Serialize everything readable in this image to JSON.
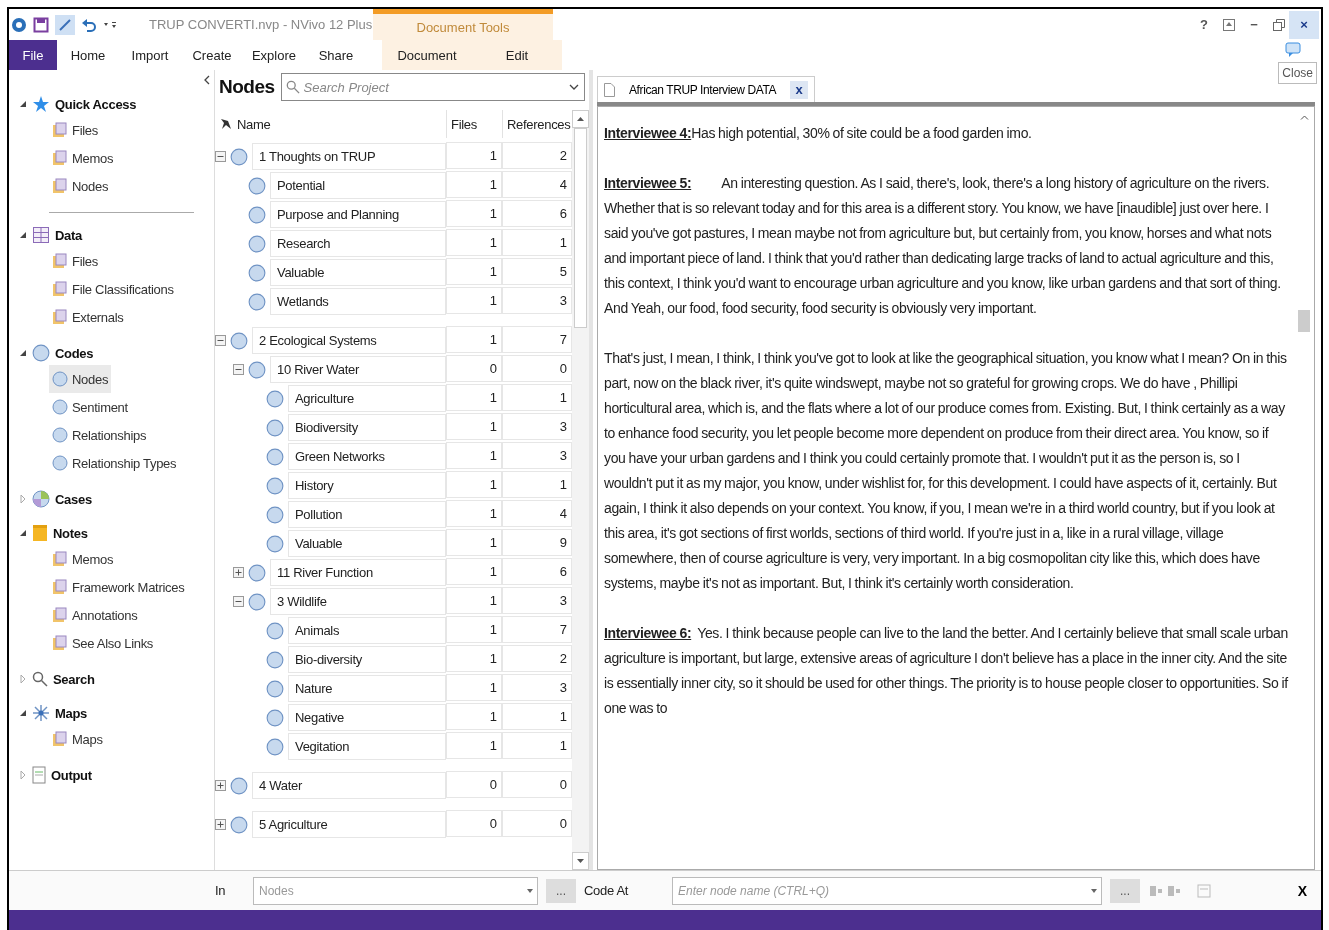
{
  "window": {
    "title": "TRUP CONVERTI.nvp - NVivo 12 Plus",
    "controls": [
      "?",
      "−",
      "×"
    ]
  },
  "ribbon": {
    "context_group": "Document Tools",
    "tabs": [
      {
        "label": "File",
        "kind": "file"
      },
      {
        "label": "Home",
        "kind": "tab"
      },
      {
        "label": "Import",
        "kind": "tab"
      },
      {
        "label": "Create",
        "kind": "tab"
      },
      {
        "label": "Explore",
        "kind": "tab"
      },
      {
        "label": "Share",
        "kind": "tab"
      },
      {
        "label": "Document",
        "kind": "context"
      },
      {
        "label": "Edit",
        "kind": "context"
      }
    ]
  },
  "tooltip": "Close",
  "navigation": [
    {
      "label": "Quick Access",
      "expanded": true,
      "children": [
        {
          "label": "Files",
          "selected": false
        },
        {
          "label": "Memos",
          "selected": false
        },
        {
          "label": "Nodes",
          "selected": false
        }
      ]
    },
    {
      "label": "Data",
      "expanded": true,
      "children": [
        {
          "label": "Files",
          "selected": false
        },
        {
          "label": "File Classifications",
          "selected": false
        },
        {
          "label": "Externals",
          "selected": false
        }
      ]
    },
    {
      "label": "Codes",
      "expanded": true,
      "children": [
        {
          "label": "Nodes",
          "selected": true
        },
        {
          "label": "Sentiment",
          "selected": false
        },
        {
          "label": "Relationships",
          "selected": false
        },
        {
          "label": "Relationship Types",
          "selected": false
        }
      ]
    },
    {
      "label": "Cases",
      "expanded": false
    },
    {
      "label": "Notes",
      "expanded": true,
      "children": [
        {
          "label": "Memos",
          "selected": false
        },
        {
          "label": "Framework Matrices",
          "selected": false
        },
        {
          "label": "Annotations",
          "selected": false
        },
        {
          "label": "See Also Links",
          "selected": false
        }
      ]
    },
    {
      "label": "Search",
      "expanded": false
    },
    {
      "label": "Maps",
      "expanded": true,
      "children": [
        {
          "label": "Maps",
          "selected": false
        }
      ]
    },
    {
      "label": "Output",
      "expanded": false
    }
  ],
  "nodes_panel": {
    "title": "Nodes",
    "search": {
      "placeholder": "Search Project"
    },
    "columns": [
      "Name",
      "Files",
      "References"
    ],
    "rows": [
      {
        "name": "1 Thoughts on TRUP",
        "files": "1",
        "references": "2",
        "expanded": true,
        "children": [
          {
            "name": "Potential",
            "files": "1",
            "references": "4"
          },
          {
            "name": "Purpose and Planning",
            "files": "1",
            "references": "6"
          },
          {
            "name": "Research",
            "files": "1",
            "references": "1"
          },
          {
            "name": "Valuable",
            "files": "1",
            "references": "5"
          },
          {
            "name": "Wetlands",
            "files": "1",
            "references": "3"
          }
        ]
      },
      {
        "name": "2 Ecological Systems",
        "files": "1",
        "references": "7",
        "expanded": true,
        "children": [
          {
            "name": "10 River Water",
            "files": "0",
            "references": "0",
            "expanded": true,
            "children": [
              {
                "name": "Agriculture",
                "files": "1",
                "references": "1"
              },
              {
                "name": "Biodiversity",
                "files": "1",
                "references": "3"
              },
              {
                "name": "Green Networks",
                "files": "1",
                "references": "3"
              },
              {
                "name": "History",
                "files": "1",
                "references": "1"
              },
              {
                "name": "Pollution",
                "files": "1",
                "references": "4"
              },
              {
                "name": "Valuable",
                "files": "1",
                "references": "9"
              }
            ]
          },
          {
            "name": "11 River Function",
            "files": "1",
            "references": "6",
            "expanded": false
          },
          {
            "name": "3 Wildlife",
            "files": "1",
            "references": "3",
            "expanded": true,
            "children": [
              {
                "name": "Animals",
                "files": "1",
                "references": "7"
              },
              {
                "name": "Bio-diversity",
                "files": "1",
                "references": "2"
              },
              {
                "name": "Nature",
                "files": "1",
                "references": "3"
              },
              {
                "name": "Negative",
                "files": "1",
                "references": "1"
              },
              {
                "name": "Vegitation",
                "files": "1",
                "references": "1"
              }
            ]
          }
        ]
      },
      {
        "name": "4 Water",
        "files": "0",
        "references": "0",
        "expanded": false
      },
      {
        "name": "5 Agriculture",
        "files": "0",
        "references": "0",
        "expanded": false
      }
    ]
  },
  "document": {
    "tab": "African TRUP Interview DATA",
    "close": "x",
    "paragraphs": [
      {
        "speaker": "Interviewee 4:",
        "text": "Has high potential, 30% of site could be a food garden imo."
      },
      {
        "speaker": "Interviewee 5:",
        "text": "An interesting question. As I said, there's, look, there's a long history of agriculture on the rivers. Whether that is so relevant today and for this area is a different story. You know, we have [inaudible] just over here.  I said you've got pastures, I mean maybe not from agriculture but, but certainly from, you know, horses and what nots and important piece of land. I think that you'd rather than dedicating large tracks of land to actual agriculture and this, this context, I think you'd want to encourage urban agriculture and you know, like urban gardens and that sort of thing. And Yeah, our food, food security, food security is obviously very important."
      },
      {
        "text": "That's just, I mean, I think, I think you've got to look at like the geographical situation, you know what I mean? On in this part, now on the black river, it's quite windswept, maybe not so grateful for growing crops. We do have , Phillipi horticultural area, which is, and the flats where a lot of our produce comes from. Existing. But, I think certainly as a way to enhance food security, you let people become more dependent on produce from their direct area. You know, so if you have your urban gardens and I think you could certainly promote that. I wouldn't put it as the person is, so I wouldn't put it as my major, you know, under wishlist for, for this development. I could have aspects of it, certainly. But again, I think it also depends on your context. You know, if you, I mean we're in a third world country, but if you look at this area, it's got sections of first worlds, sections of third world.  If you're just in a, like in a rural village, village somewhere, then of course agriculture is very, very important. In a big cosmopolitan city like this, which does have systems, maybe it's not as important. But, I think it's certainly worth consideration."
      },
      {
        "speaker": "Interviewee 6:",
        "text": "Yes. I think because people can live to the land the better. And I certainly believe that small scale urban agriculture is important, but large, extensive areas of agriculture I don't believe has a place in the inner city. And the site is essentially inner city, so it should be used for other things. The priority is to house people closer to opportunities. So if one was to"
      }
    ]
  },
  "coding_bar": {
    "in_label": "In",
    "in_field": {
      "placeholder": "Nodes"
    },
    "browse": "...",
    "code_at_label": "Code At",
    "code_at_field": {
      "placeholder": "Enter node name (CTRL+Q)"
    },
    "close": "X"
  }
}
